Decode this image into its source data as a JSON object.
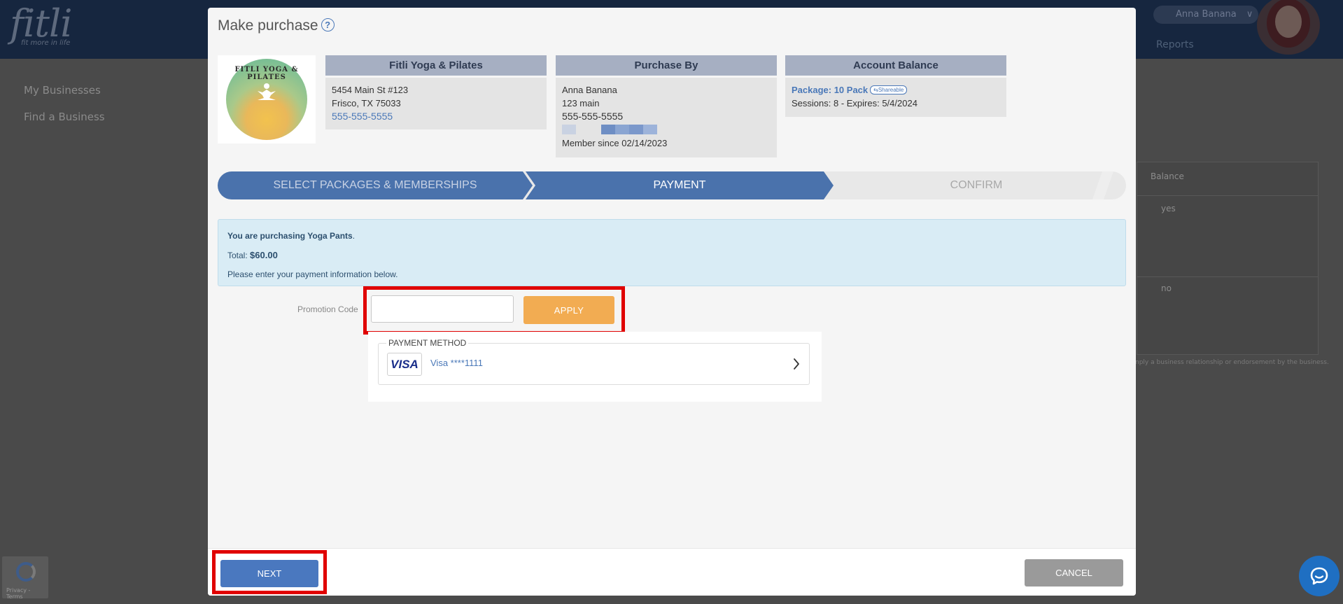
{
  "background": {
    "logo": "fitli",
    "logo_tagline": "fit more in life",
    "user_name": "Anna Banana",
    "user_caret": "∨",
    "nav_reports": "Reports",
    "sidebar": [
      "My Businesses",
      "Find a Business"
    ],
    "table": {
      "header": "Balance",
      "rows": [
        "yes",
        "no"
      ]
    },
    "footnote": "nply a business relationship or endorsement by the business.",
    "recaptcha_text": "Privacy - Terms"
  },
  "modal": {
    "title": "Make purchase",
    "help_glyph": "?",
    "business": {
      "header": "Fitli Yoga & Pilates",
      "logo_text": "FITLI YOGA & PILATES",
      "address1": "5454 Main St #123",
      "address2": "Frisco, TX 75033",
      "phone": "555-555-5555"
    },
    "purchaser": {
      "header": "Purchase By",
      "name": "Anna Banana",
      "address": "123 main",
      "phone": "555-555-5555",
      "member_since": "Member since 02/14/2023"
    },
    "account": {
      "header": "Account Balance",
      "package_label": "Package: 10 Pack",
      "share_badge": "Shareable",
      "sessions": "Sessions: 8 - Expires: 5/4/2024"
    },
    "steps": [
      "SELECT PACKAGES & MEMBERSHIPS",
      "PAYMENT",
      "CONFIRM"
    ],
    "active_step": "PAYMENT",
    "alert": {
      "line1": "You are purchasing Yoga Pants",
      "line1_end": ".",
      "total_label": "Total:",
      "total_value": "$60.00",
      "line3": "Please enter your payment information below."
    },
    "promo": {
      "label": "Promotion Code",
      "value": "",
      "apply_label": "APPLY"
    },
    "payment_method": {
      "legend": "PAYMENT METHOD",
      "card_brand": "VISA",
      "card_text": "Visa ****1111"
    },
    "footer": {
      "next_label": "NEXT",
      "cancel_label": "CANCEL"
    }
  },
  "colors": {
    "primary": "#4a72ac",
    "apply": "#f2ac52",
    "highlight": "#e00000",
    "link": "#4a78b8"
  }
}
